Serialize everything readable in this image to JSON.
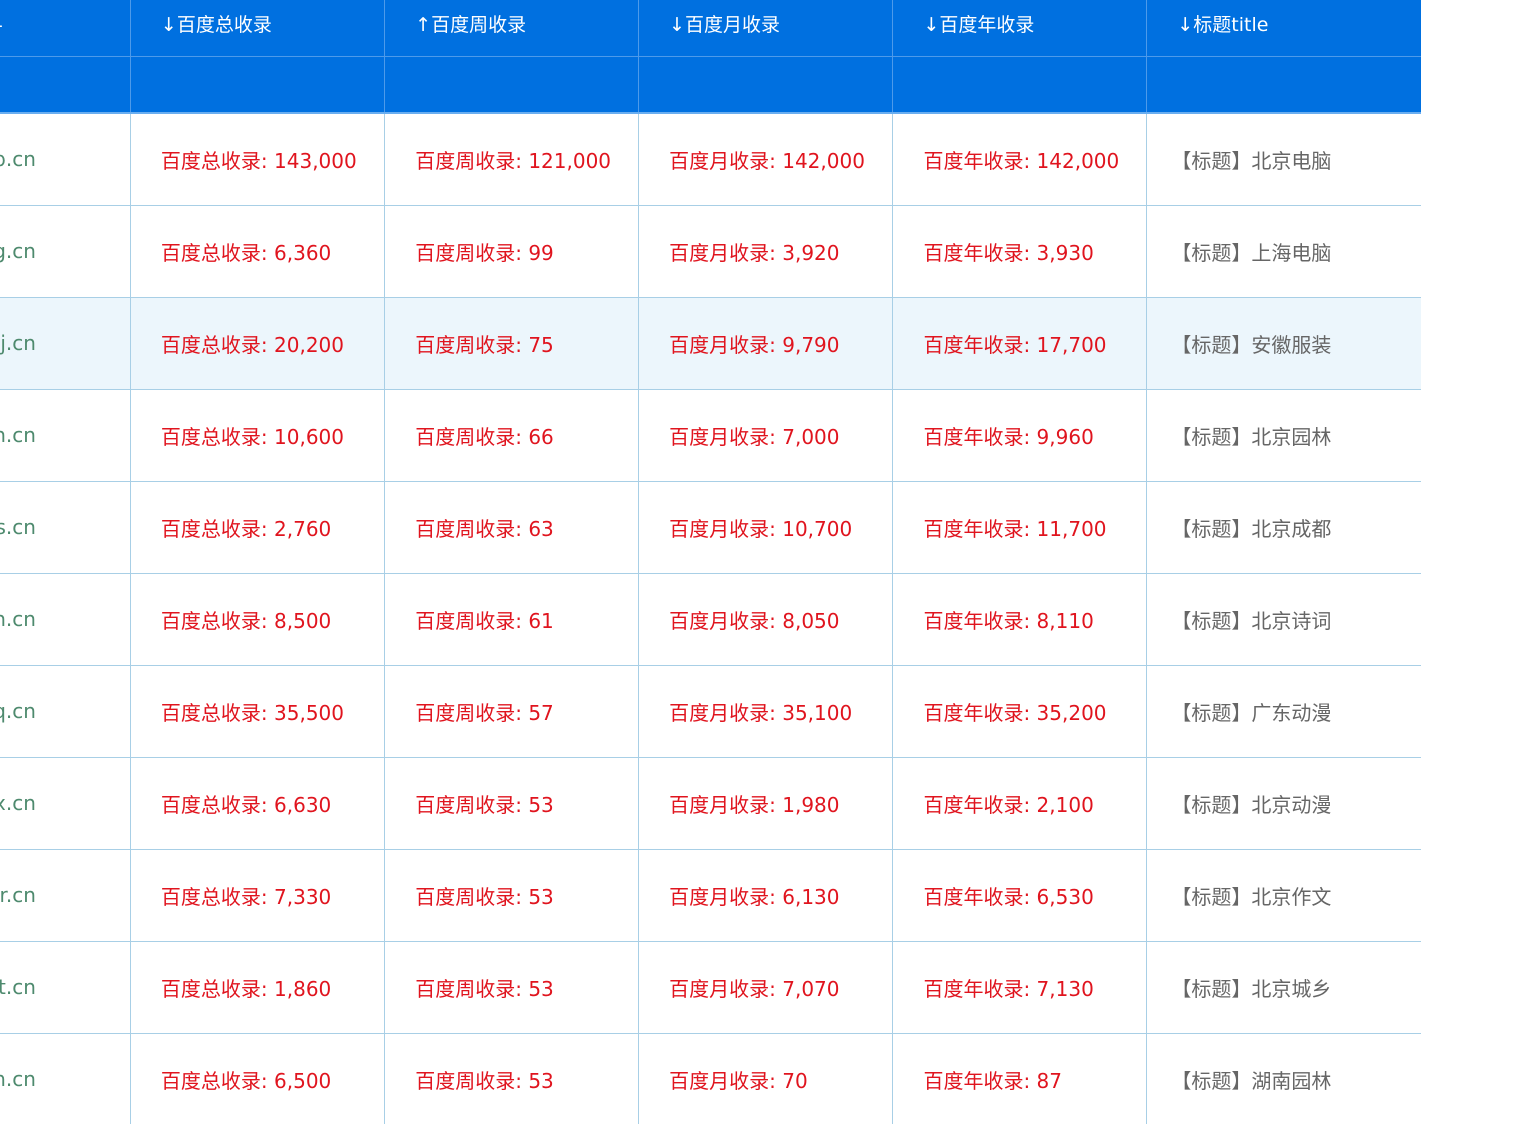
{
  "columns": {
    "url": "RL",
    "total": "↓百度总收录",
    "week": "↑百度周收录",
    "month": "↓百度月收录",
    "year": "↓百度年收录",
    "title": "↓标题title"
  },
  "rows": [
    {
      "url": "gfphb.cn",
      "total": "百度总收录: 143,000",
      "week": "百度周收录: 121,000",
      "month": "百度月收录: 142,000",
      "year": "百度年收录: 142,000",
      "title": "【标题】北京电脑"
    },
    {
      "url": "bgfnhg.cn",
      "total": "百度总收录: 6,360",
      "week": "百度周收录: 99",
      "month": "百度月收录: 3,920",
      "year": "百度年收录: 3,930",
      "title": "【标题】上海电脑"
    },
    {
      "url": "ugfxhj.cn",
      "total": "百度总收录: 20,200",
      "week": "百度周收录: 75",
      "month": "百度月收录: 9,790",
      "year": "百度年收录: 17,700",
      "title": "【标题】安徽服装"
    },
    {
      "url": "bgfkhn.cn",
      "total": "百度总收录: 10,600",
      "week": "百度周收录: 66",
      "month": "百度月收录: 7,000",
      "year": "百度年收录: 9,960",
      "title": "【标题】北京园林"
    },
    {
      "url": "ugfxhs.cn",
      "total": "百度总收录: 2,760",
      "week": "百度周收录: 63",
      "month": "百度月收录: 10,700",
      "year": "百度年收录: 11,700",
      "title": "【标题】北京成都"
    },
    {
      "url": "gfphh.cn",
      "total": "百度总收录: 8,500",
      "week": "百度周收录: 61",
      "month": "百度月收录: 8,050",
      "year": "百度年收录: 8,110",
      "title": "【标题】北京诗词"
    },
    {
      "url": "cgfkhq.cn",
      "total": "百度总收录: 35,500",
      "week": "百度周收录: 57",
      "month": "百度月收录: 35,100",
      "year": "百度年收录: 35,200",
      "title": "【标题】广东动漫"
    },
    {
      "url": "ugfxhx.cn",
      "total": "百度总收录: 6,630",
      "week": "百度周收录: 53",
      "month": "百度月收录: 1,980",
      "year": "百度年收录: 2,100",
      "title": "【标题】北京动漫"
    },
    {
      "url": "ugfxhr.cn",
      "total": "百度总收录: 7,330",
      "week": "百度周收录: 53",
      "month": "百度月收录: 6,130",
      "year": "百度年收录: 6,530",
      "title": "【标题】北京作文"
    },
    {
      "url": "ugfxht.cn",
      "total": "百度总收录: 1,860",
      "week": "百度周收录: 53",
      "month": "百度月收录: 7,070",
      "year": "百度年收录: 7,130",
      "title": "【标题】北京城乡"
    },
    {
      "url": "bgfvhm.cn",
      "total": "百度总收录: 6,500",
      "week": "百度周收录: 53",
      "month": "百度月收录: 70",
      "year": "百度年收录: 87",
      "title": "【标题】湖南园林"
    }
  ],
  "highlighted_row": 2,
  "colors": {
    "header_bg": "#0070e0",
    "url_text": "#4e8a6e",
    "number_text": "#e0141e",
    "title_text": "#666666",
    "row_highlight": "#ecf6fc",
    "grid_line": "#a8cfe6"
  }
}
